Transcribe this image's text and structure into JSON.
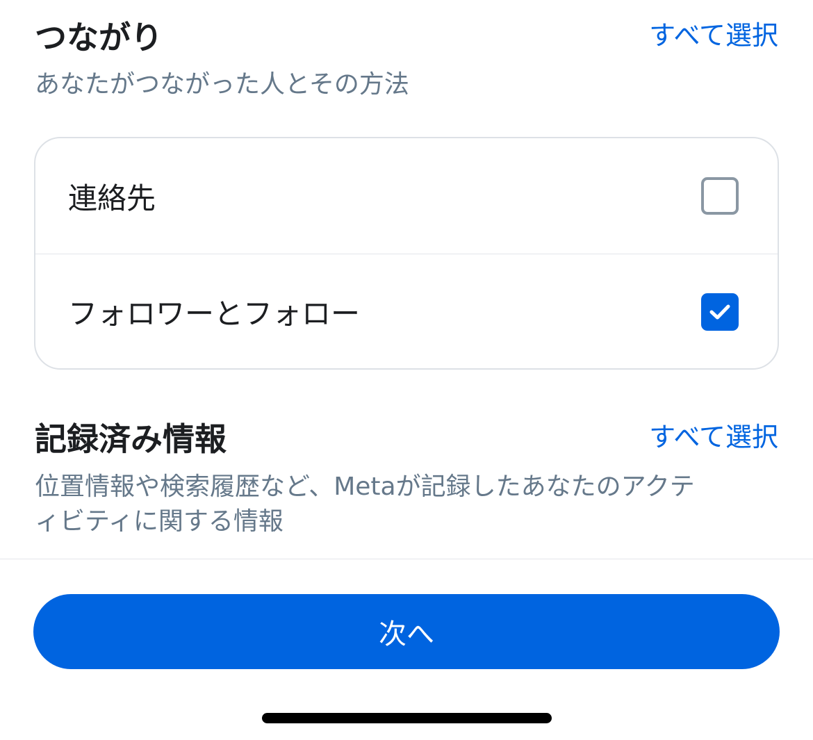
{
  "connections": {
    "title": "つながり",
    "select_all": "すべて選択",
    "description": "あなたがつながった人とその方法",
    "items": [
      {
        "label": "連絡先",
        "checked": false
      },
      {
        "label": "フォロワーとフォロー",
        "checked": true
      }
    ]
  },
  "logged_info": {
    "title": "記録済み情報",
    "select_all": "すべて選択",
    "description_line1": "位置情報や検索履歴など、Metaが記録したあなたのアクテ",
    "description_line2": "ィビティに関する情報"
  },
  "footer": {
    "next_label": "次へ"
  },
  "colors": {
    "accent": "#0064e0",
    "text_primary": "#1c1e21",
    "text_secondary": "#65788a",
    "checkbox_border": "#8a97a3"
  },
  "icons": {
    "checkmark": "check-icon"
  }
}
